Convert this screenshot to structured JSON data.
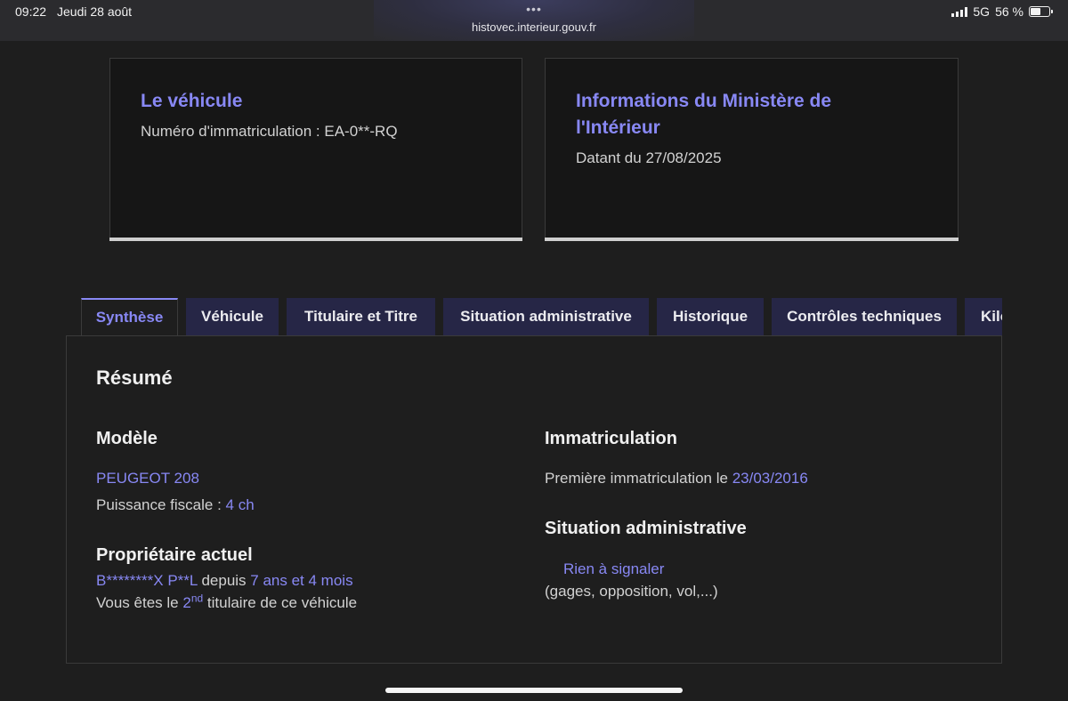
{
  "status": {
    "time": "09:22",
    "date": "Jeudi 28 août",
    "network": "5G",
    "battery": "56 %",
    "url_dots": "•••",
    "url": "histovec.interieur.gouv.fr"
  },
  "cards": {
    "vehicle": {
      "title": "Le véhicule",
      "plate_label": "Numéro d'immatriculation : EA-0**-RQ"
    },
    "ministry": {
      "title": "Informations du Ministère de l'Intérieur",
      "date_label": "Datant du 27/08/2025"
    }
  },
  "tabs": [
    "Synthèse",
    "Véhicule",
    "Titulaire et Titre",
    "Situation administrative",
    "Historique",
    "Contrôles techniques",
    "Kilométrage"
  ],
  "summary": {
    "heading": "Résumé",
    "model": {
      "heading": "Modèle",
      "name": "PEUGEOT 208",
      "power_label": "Puissance fiscale : ",
      "power_value": "4 ch"
    },
    "owner": {
      "heading": "Propriétaire actuel",
      "name": "B********X P**L",
      "since_label": " depuis ",
      "since_value": "7 ans et 4 mois",
      "rank_prefix": "Vous êtes le ",
      "rank_value": "2",
      "rank_sup": "nd",
      "rank_suffix": " titulaire de ce véhicule"
    },
    "registration": {
      "heading": "Immatriculation",
      "first_label": "Première immatriculation le ",
      "first_value": "23/03/2016"
    },
    "admin": {
      "heading": "Situation administrative",
      "status": "Rien à signaler",
      "note": "(gages, opposition, vol,...)"
    }
  }
}
